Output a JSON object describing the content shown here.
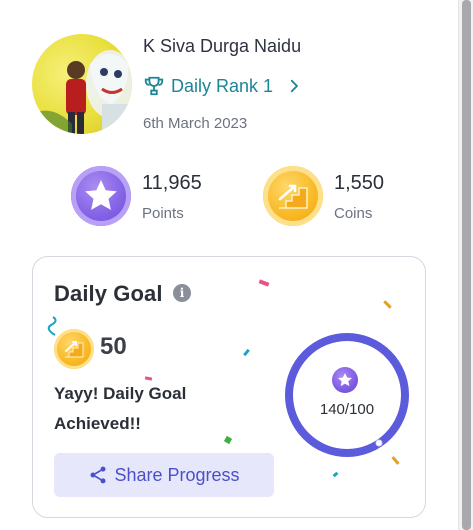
{
  "profile": {
    "name": "K Siva Durga Naidu",
    "rank_label": "Daily Rank 1",
    "date": "6th March 2023"
  },
  "stats": {
    "points_value": "11,965",
    "points_label": "Points",
    "coins_value": "1,550",
    "coins_label": "Coins"
  },
  "goal": {
    "title": "Daily Goal",
    "info_glyph": "i",
    "target": "50",
    "message": "Yayy! Daily Goal Achieved!!",
    "progress_text": "140/100",
    "progress_fraction": 1.0,
    "share_label": "Share Progress"
  },
  "colors": {
    "accent_teal": "#1e8596",
    "ring_purple": "#5b5bdc",
    "share_bg": "#e6e7fb",
    "share_text": "#4b4fc9"
  }
}
